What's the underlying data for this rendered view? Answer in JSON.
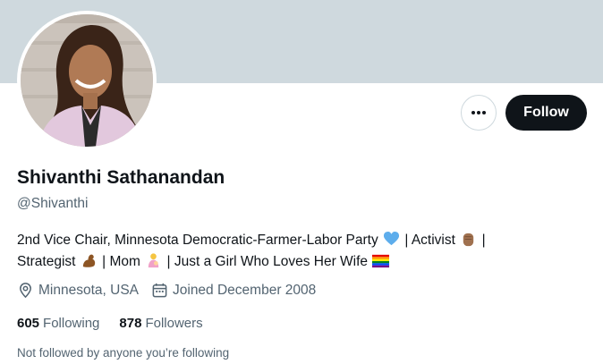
{
  "profile": {
    "name": "Shivanthi Sathanandan",
    "handle": "@Shivanthi",
    "bio": {
      "line1_a": "2nd Vice Chair, Minnesota Democratic-Farmer-Labor Party",
      "line1_b": "| Activist",
      "line1_c": "|",
      "line2_a": "Strategist",
      "line2_b": "| Mom",
      "line2_c": "| Just a Girl Who Loves Her Wife"
    },
    "location": "Minnesota, USA",
    "joined": "Joined December 2008"
  },
  "stats": {
    "following_count": "605",
    "following_label": "Following",
    "followers_count": "878",
    "followers_label": "Followers"
  },
  "actions": {
    "follow_label": "Follow"
  },
  "note": "Not followed by anyone you’re following",
  "colors": {
    "banner": "#cfd9de",
    "follow_bg": "#0f1419",
    "secondary_text": "#536471"
  },
  "icons": {
    "more": "more-dots-icon",
    "location": "location-pin-icon",
    "calendar": "calendar-icon",
    "blue_heart": "blue-heart-emoji",
    "raised_fist": "raised-fist-emoji",
    "flexed_biceps": "flexed-biceps-emoji",
    "mom": "woman-feeding-baby-emoji",
    "pride_flag": "rainbow-flag-emoji"
  }
}
